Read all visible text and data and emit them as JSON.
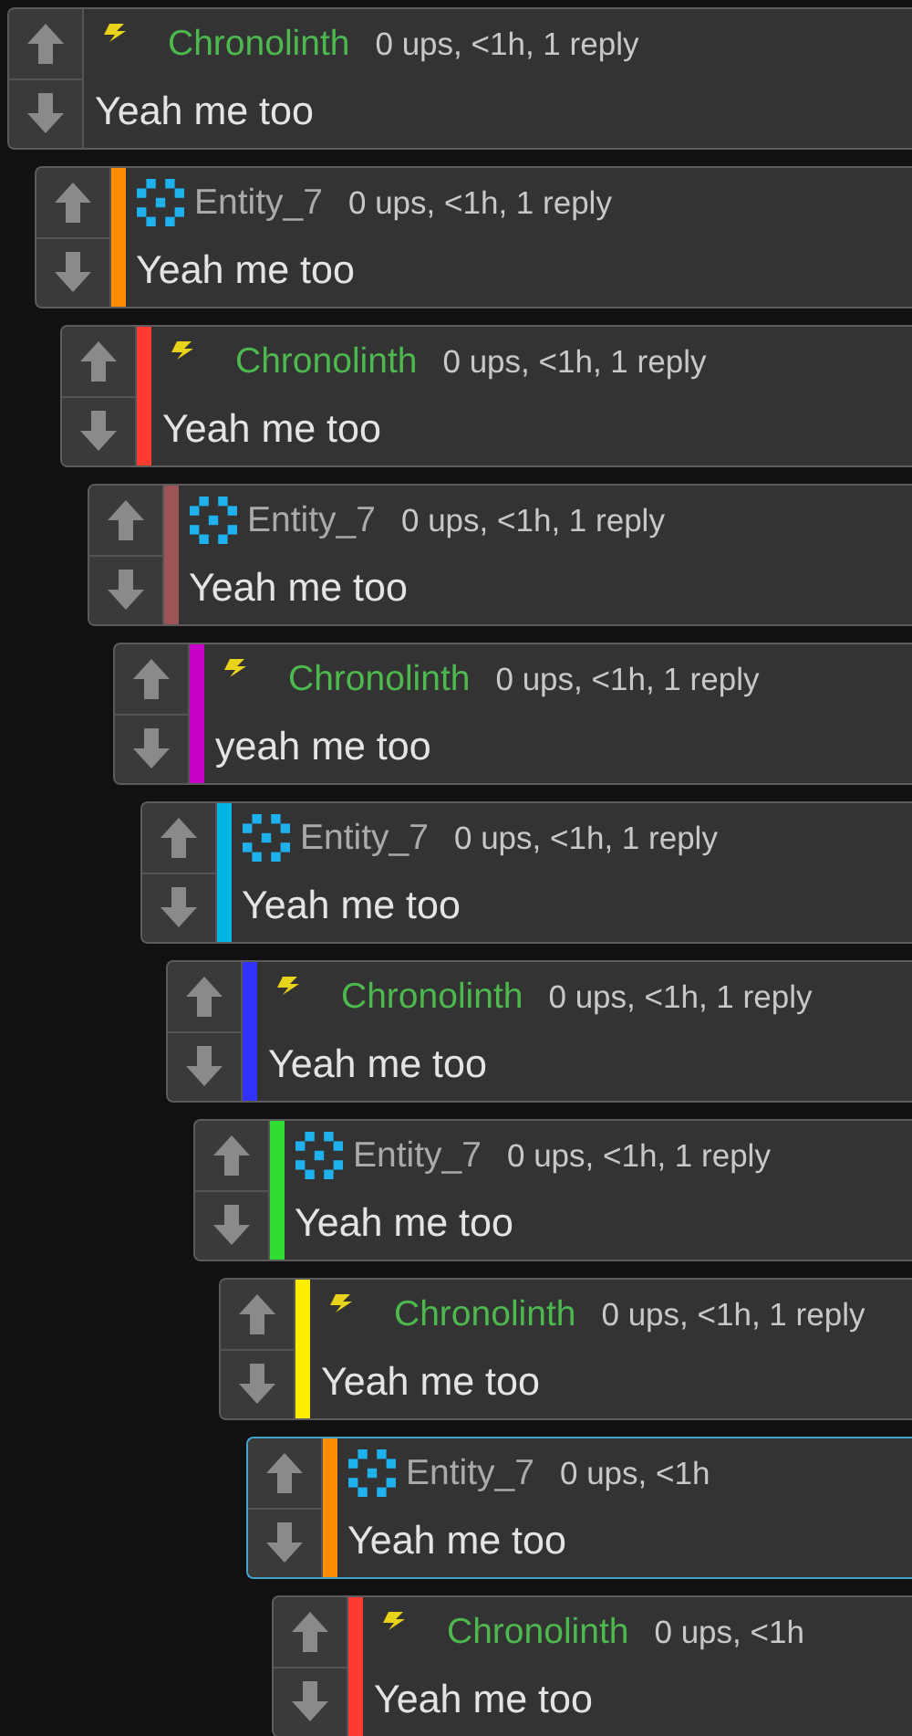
{
  "thread": [
    {
      "kind": "bolt",
      "author": "Chronolinth",
      "meta": "0 ups, <1h, 1 reply",
      "text": "Yeah me too",
      "highlighted": false,
      "children": [
        {
          "kind": "pixel",
          "author": "Entity_7",
          "meta": "0 ups, <1h, 1 reply",
          "text": "Yeah me too",
          "color": "#ff8c00",
          "highlighted": false,
          "children": [
            {
              "kind": "bolt",
              "author": "Chronolinth",
              "meta": "0 ups, <1h, 1 reply",
              "text": "Yeah me too",
              "color": "#ff3b30",
              "highlighted": false,
              "children": [
                {
                  "kind": "pixel",
                  "author": "Entity_7",
                  "meta": "0 ups, <1h, 1 reply",
                  "text": "Yeah me too",
                  "color": "#9b5555",
                  "highlighted": false,
                  "children": [
                    {
                      "kind": "bolt",
                      "author": "Chronolinth",
                      "meta": "0 ups, <1h, 1 reply",
                      "text": "yeah me too",
                      "color": "#c800c8",
                      "highlighted": false,
                      "children": [
                        {
                          "kind": "pixel",
                          "author": "Entity_7",
                          "meta": "0 ups, <1h, 1 reply",
                          "text": "Yeah me too",
                          "color": "#00b4e6",
                          "highlighted": false,
                          "children": [
                            {
                              "kind": "bolt",
                              "author": "Chronolinth",
                              "meta": "0 ups, <1h, 1 reply",
                              "text": "Yeah me too",
                              "color": "#3232ff",
                              "highlighted": false,
                              "children": [
                                {
                                  "kind": "pixel",
                                  "author": "Entity_7",
                                  "meta": "0 ups, <1h, 1 reply",
                                  "text": "Yeah me too",
                                  "color": "#32dc32",
                                  "highlighted": false,
                                  "children": [
                                    {
                                      "kind": "bolt",
                                      "author": "Chronolinth",
                                      "meta": "0 ups, <1h, 1 reply",
                                      "text": "Yeah me too",
                                      "color": "#ffee00",
                                      "highlighted": false,
                                      "children": [
                                        {
                                          "kind": "pixel",
                                          "author": "Entity_7",
                                          "meta": "0 ups, <1h",
                                          "text": "Yeah me too",
                                          "color": "#ff8c00",
                                          "highlighted": true,
                                          "children": [
                                            {
                                              "kind": "bolt",
                                              "author": "Chronolinth",
                                              "meta": "0 ups, <1h",
                                              "text": "Yeah me too",
                                              "color": "#ff3b30",
                                              "highlighted": false
                                            }
                                          ]
                                        }
                                      ]
                                    }
                                  ]
                                }
                              ]
                            }
                          ]
                        }
                      ]
                    }
                  ]
                }
              ]
            }
          ]
        }
      ]
    }
  ]
}
